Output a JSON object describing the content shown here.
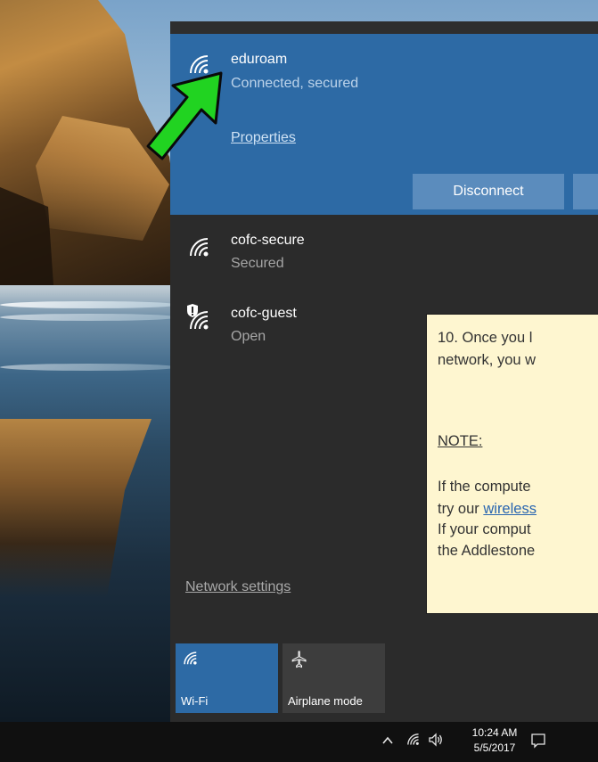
{
  "flyout": {
    "connected_network": {
      "name": "eduroam",
      "status": "Connected, secured",
      "properties_label": "Properties",
      "disconnect_label": "Disconnect"
    },
    "networks": [
      {
        "name": "cofc-secure",
        "status": "Secured",
        "icon": "wifi-icon"
      },
      {
        "name": "cofc-guest",
        "status": "Open",
        "icon": "wifi-shield-icon"
      }
    ],
    "network_settings_label": "Network settings",
    "quick_actions": [
      {
        "label": "Wi-Fi",
        "icon": "wifi-icon",
        "active": true
      },
      {
        "label": "Airplane mode",
        "icon": "airplane-icon",
        "active": false
      }
    ]
  },
  "note": {
    "line1": "10.  Once you l",
    "line2": "network, you w",
    "heading": "NOTE:",
    "line3": "If the compute",
    "line4_prefix": "try our ",
    "line4_link": "wireless",
    "line5": "If your comput",
    "line6": "the Addlestone"
  },
  "taskbar": {
    "time": "10:24 AM",
    "date": "5/5/2017",
    "tray_icons": [
      "chevron-up-icon",
      "wifi-icon",
      "volume-icon",
      "action-center-icon"
    ]
  },
  "colors": {
    "accent": "#2d6aa5",
    "flyout_bg": "#2b2b2b",
    "note_bg": "#fef6d0",
    "arrow": "#21d321"
  }
}
